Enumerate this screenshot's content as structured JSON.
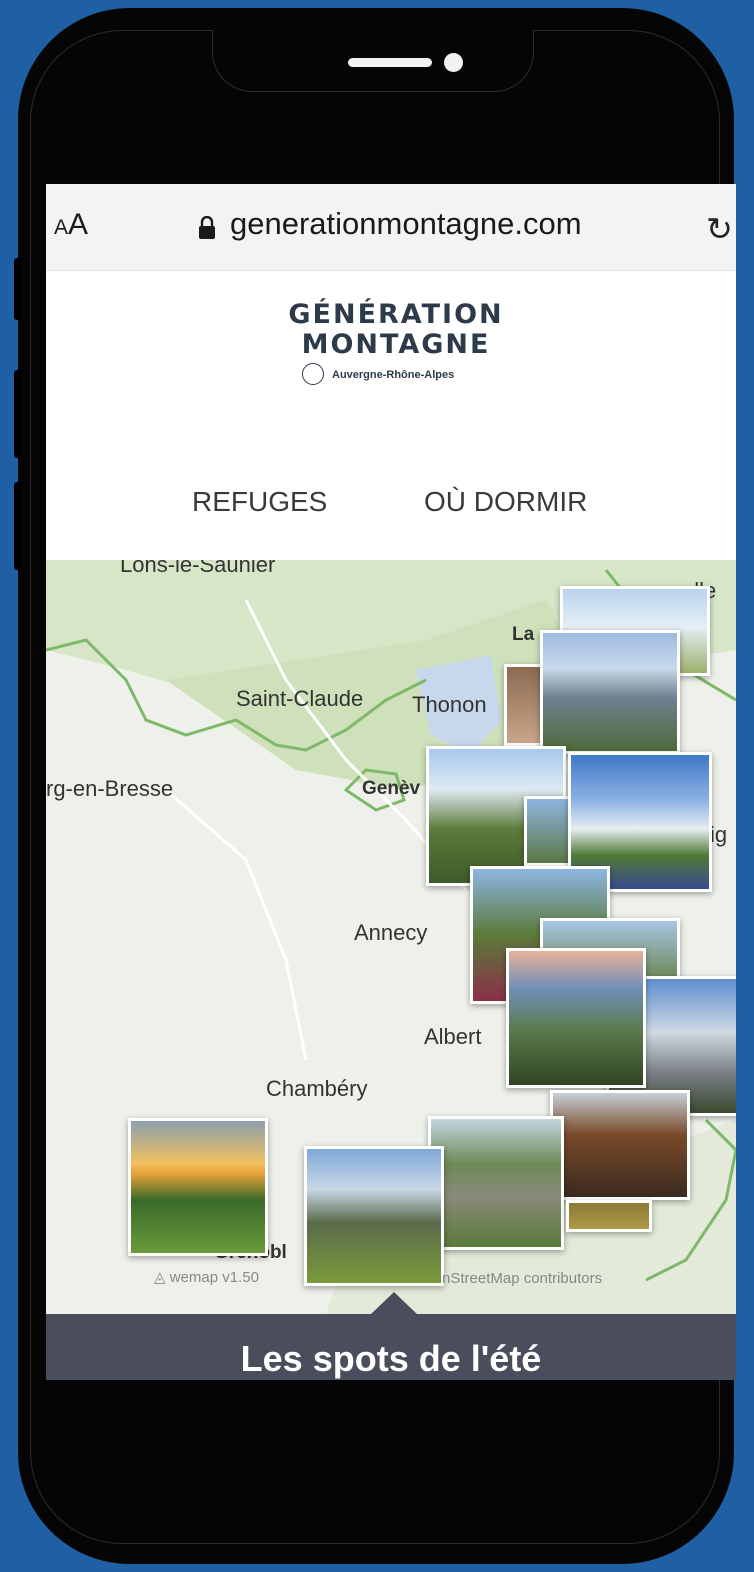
{
  "browser": {
    "text_size_label_small": "A",
    "text_size_label_large": "A",
    "url": "generationmontagne.com"
  },
  "logo": {
    "line1": "GÉNÉRATION",
    "line2": "MONTAGNE",
    "region": "Auvergne-Rhône-Alpes"
  },
  "nav": {
    "items": [
      "REFUGES",
      "OÙ DORMIR"
    ]
  },
  "map": {
    "places": [
      "Lons-le-Saunier",
      "Saint-Claude",
      "Thonon",
      "rg-en-Bresse",
      "Genèv",
      "Annecy",
      "Albert",
      "Chambéry",
      "Grenobl",
      "La",
      "ulle",
      "ig"
    ],
    "attribution_logo": "wemap",
    "attribution_version": "v1.50",
    "attribution_osm": "nStreetMap contributors"
  },
  "bottom_panel": {
    "title": "Les spots de l'été"
  }
}
